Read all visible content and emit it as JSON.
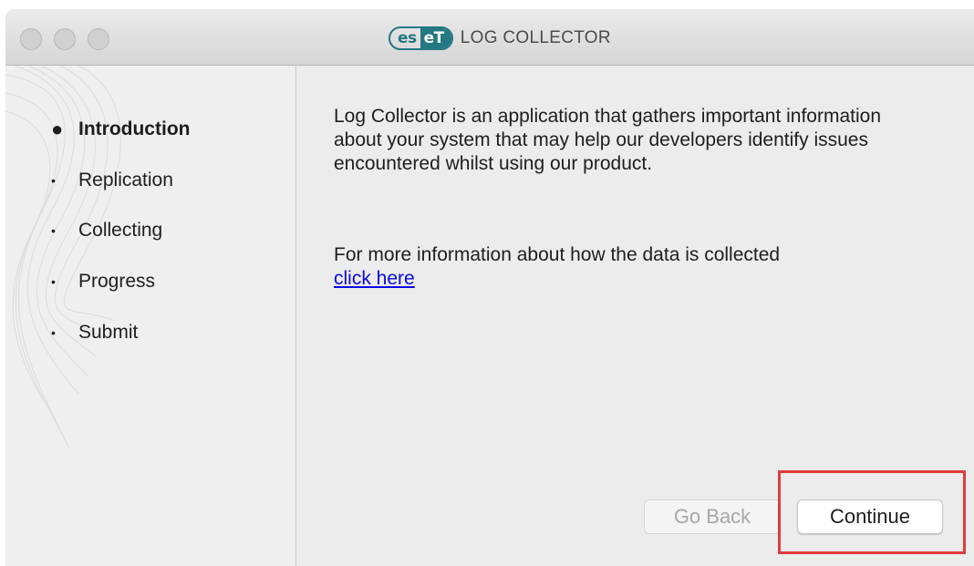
{
  "window": {
    "title_logo_left": "es",
    "title_logo_right": "eT",
    "title": "LOG COLLECTOR"
  },
  "sidebar": {
    "items": [
      {
        "label": "Introduction",
        "active": true
      },
      {
        "label": "Replication",
        "active": false
      },
      {
        "label": "Collecting",
        "active": false
      },
      {
        "label": "Progress",
        "active": false
      },
      {
        "label": "Submit",
        "active": false
      }
    ]
  },
  "content": {
    "paragraph1": "Log Collector is an application that gathers important information about your system that may help our developers identify issues encountered whilst using our product.",
    "paragraph2": "For more information about how the data is collected",
    "link_text": "click here"
  },
  "buttons": {
    "back_label": "Go Back",
    "continue_label": "Continue",
    "back_enabled": false
  },
  "colors": {
    "brand": "#247882",
    "link": "#0a0ae6",
    "highlight": "#e03c3c"
  }
}
